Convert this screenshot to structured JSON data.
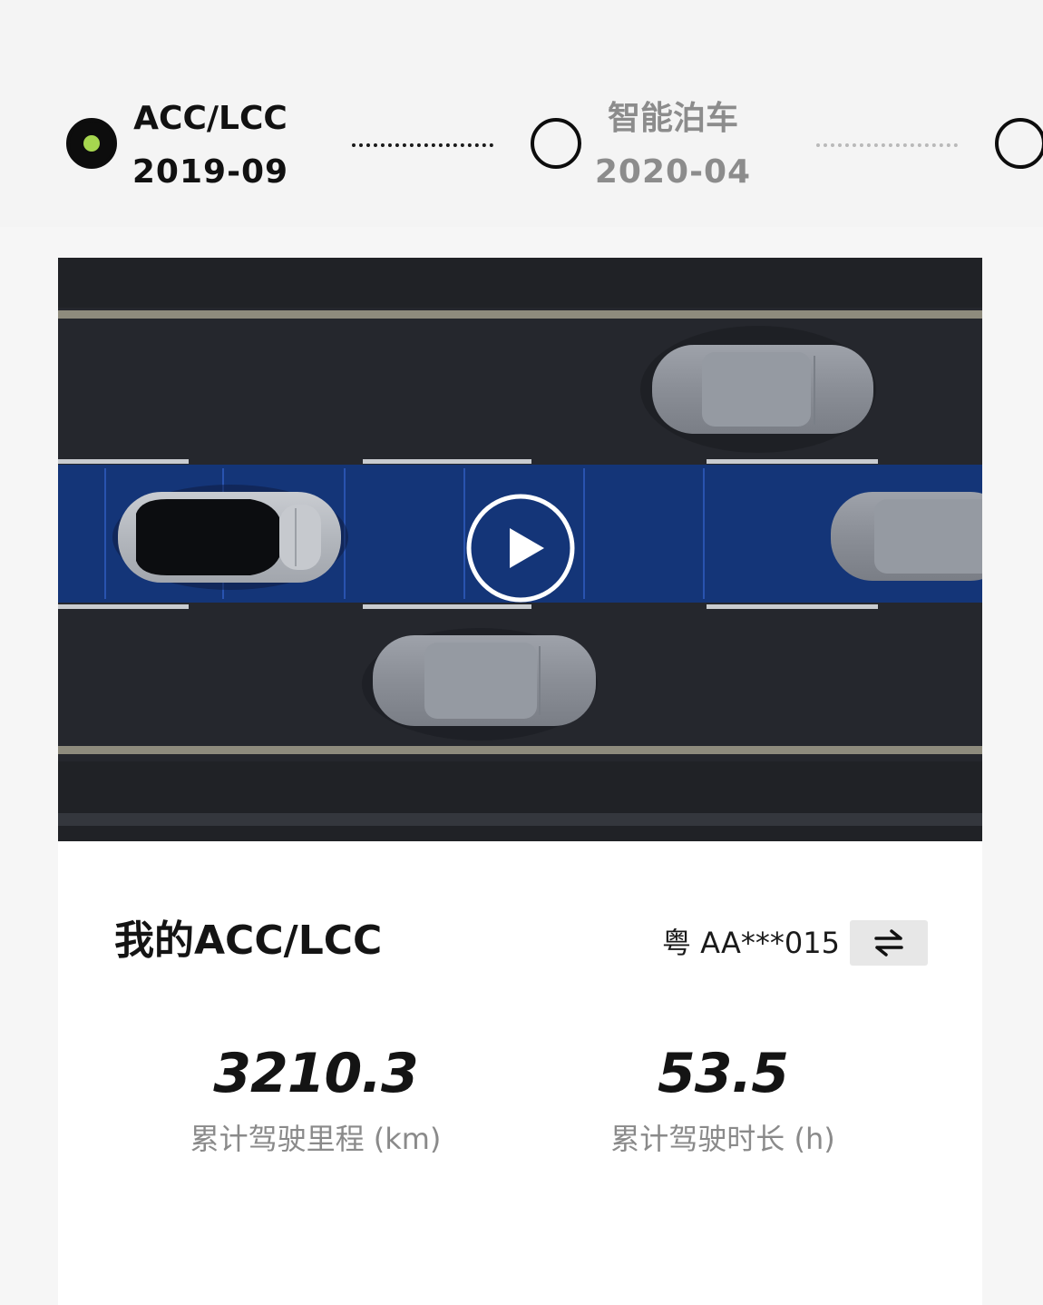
{
  "timeline": {
    "items": [
      {
        "name": "ACC/LCC",
        "date": "2019-09",
        "state": "active"
      },
      {
        "name": "智能泊车",
        "date": "2020-04",
        "state": "inactive"
      }
    ]
  },
  "video": {
    "play_icon": "play-icon"
  },
  "card": {
    "title": "我的ACC/LCC",
    "plate": "粤 AA***015",
    "switch_icon": "swap-arrows-icon",
    "stats": [
      {
        "value": "3210.3",
        "label": "累计驾驶里程 (km)"
      },
      {
        "value": "53.5",
        "label": "累计驾驶时长 (h)"
      }
    ]
  },
  "colors": {
    "active_dot": "#a6d64f",
    "lane_highlight": "#123a8c",
    "road": "#25272d"
  }
}
